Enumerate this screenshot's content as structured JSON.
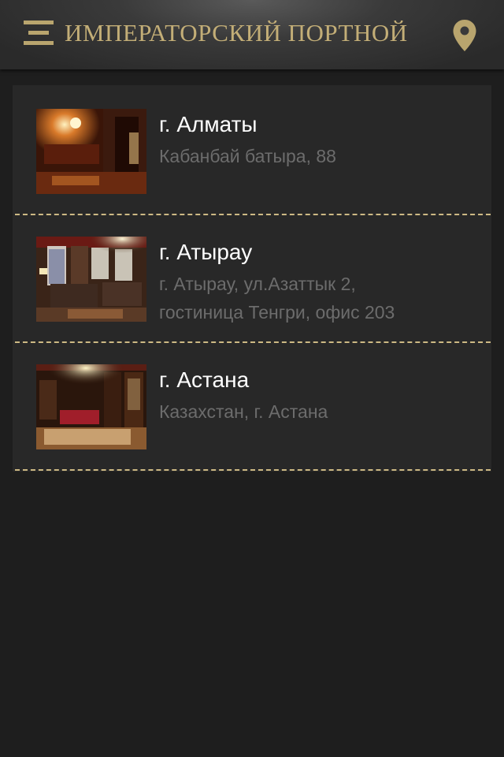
{
  "header": {
    "title": "ИМПЕРАТОРСКИЙ ПОРТНОЙ",
    "menu_icon": "menu-icon",
    "location_icon": "map-pin-icon",
    "accent_color": "#c3ae77"
  },
  "locations": [
    {
      "city": "г. Алматы",
      "address": "Кабанбай батыра, 88",
      "image": "salon-interior-photo"
    },
    {
      "city": "г. Атырау",
      "address": "г. Атырау, ул.Азаттык 2, гостиница Тенгри, офис 203",
      "image": "salon-interior-photo"
    },
    {
      "city": "г. Астана",
      "address": "Казахстан, г. Астана",
      "image": "salon-interior-photo"
    }
  ]
}
